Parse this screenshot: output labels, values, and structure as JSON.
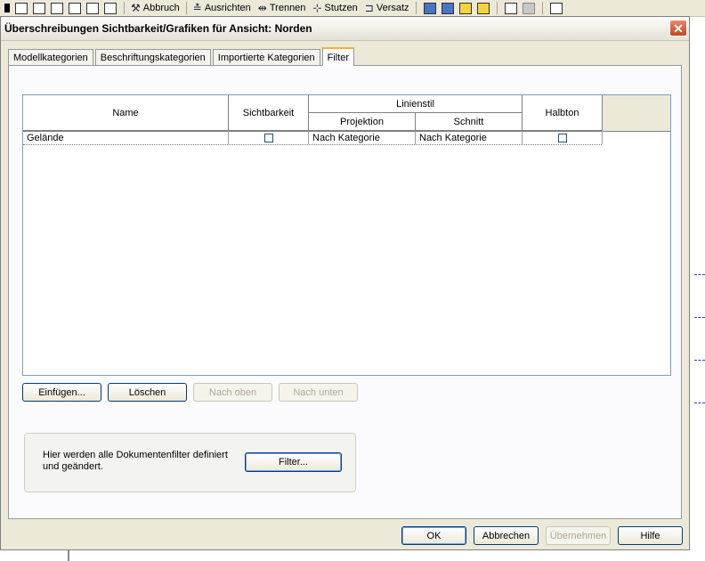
{
  "toolbar": {
    "buttons": [
      {
        "label": "Abbruch",
        "icon": "hammer-icon"
      },
      {
        "label": "Ausrichten",
        "icon": "align-icon"
      },
      {
        "label": "Trennen",
        "icon": "split-icon"
      },
      {
        "label": "Stutzen",
        "icon": "trim-icon"
      },
      {
        "label": "Versatz",
        "icon": "offset-icon"
      }
    ]
  },
  "dialog": {
    "title": "Überschreibungen Sichtbarkeit/Grafiken für Ansicht: Norden",
    "close_glyph": "✕",
    "tabs": [
      {
        "label": "Modellkategorien",
        "active": false
      },
      {
        "label": "Beschriftungskategorien",
        "active": false
      },
      {
        "label": "Importierte Kategorien",
        "active": false
      },
      {
        "label": "Filter",
        "active": true
      }
    ],
    "table": {
      "headers": {
        "name": "Name",
        "visibility": "Sichtbarkeit",
        "line_style": "Linienstil",
        "projection": "Projektion",
        "cut": "Schnitt",
        "halftone": "Halbton"
      },
      "rows": [
        {
          "name": "Gelände",
          "visibility": false,
          "projection": "Nach Kategorie",
          "cut": "Nach Kategorie",
          "halftone": false
        }
      ]
    },
    "row_buttons": {
      "insert": "Einfügen...",
      "delete": "Löschen",
      "move_up": "Nach oben",
      "move_down": "Nach unten"
    },
    "filter_group": {
      "text": "Hier werden alle Dokumentenfilter definiert und geändert.",
      "button": "Filter..."
    },
    "footer": {
      "ok": "OK",
      "cancel": "Abbrechen",
      "apply": "Übernehmen",
      "help": "Hilfe"
    }
  }
}
